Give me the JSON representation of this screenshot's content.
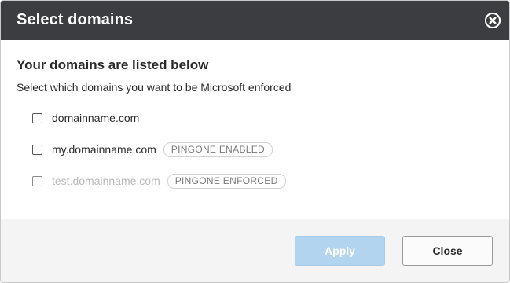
{
  "dialog": {
    "title": "Select domains",
    "heading": "Your domains are listed below",
    "subtext": "Select which domains you want to be Microsoft enforced",
    "domains": [
      {
        "name": "domainname.com",
        "checked": false,
        "disabled": false,
        "badge": ""
      },
      {
        "name": "my.domainname.com",
        "checked": false,
        "disabled": false,
        "badge": "PINGONE ENABLED"
      },
      {
        "name": "test.domainname.com",
        "checked": false,
        "disabled": true,
        "badge": "PINGONE ENFORCED"
      }
    ],
    "apply_label": "Apply",
    "close_label": "Close"
  },
  "colors": {
    "header_bg": "#3b3d40",
    "apply_bg": "#b3d4ef",
    "footer_bg": "#f4f4f4"
  },
  "icons": {
    "close": "close-circle-icon",
    "checkbox": "checkbox-unchecked"
  }
}
